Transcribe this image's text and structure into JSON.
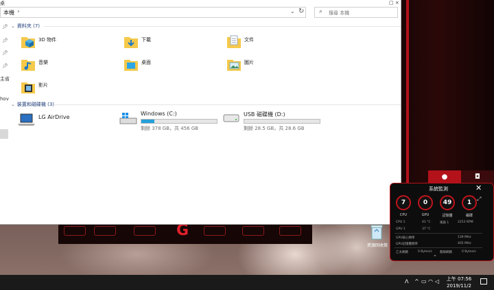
{
  "explorer": {
    "top_left_fragment": "桌",
    "top_right_controls": "▢ ×",
    "address": {
      "path": "本機",
      "separator": "›"
    },
    "search": {
      "placeholder": "搜尋 本機"
    },
    "nav": {
      "labels": [
        "主省",
        "hov"
      ]
    },
    "folders_section": {
      "title": "資料夾 (7)"
    },
    "folders": [
      {
        "name": "3D 物件",
        "icon": "3d-objects-icon"
      },
      {
        "name": "下載",
        "icon": "downloads-icon"
      },
      {
        "name": "文件",
        "icon": "documents-icon"
      },
      {
        "name": "音樂",
        "icon": "music-icon"
      },
      {
        "name": "桌面",
        "icon": "desktop-icon"
      },
      {
        "name": "圖片",
        "icon": "pictures-icon"
      },
      {
        "name": "影片",
        "icon": "videos-icon"
      }
    ],
    "drives_section": {
      "title": "裝置和磁碟機 (3)"
    },
    "drives": [
      {
        "name": "LG AirDrive",
        "icon": "laptop-icon",
        "bar": false
      },
      {
        "name": "Windows (C:)",
        "icon": "windows-drive-icon",
        "bar": true,
        "used_fraction": 0.17,
        "info": "剩餘 378 GB，共 456 GB"
      },
      {
        "name": "USB 磁碟機 (D:)",
        "icon": "usb-drive-icon",
        "bar": true,
        "used_fraction": 0.0,
        "info": "剩餘 28.5 GB，共 28.6 GB"
      }
    ]
  },
  "desktop": {
    "icon_label": "資源回收筒"
  },
  "monitor": {
    "title": "系統監測",
    "gauges": [
      {
        "value": "7",
        "label": "CPU"
      },
      {
        "value": "0",
        "label": "GPU"
      },
      {
        "value": "49",
        "label": "記憶體"
      },
      {
        "value": "1",
        "label": "磁碟"
      }
    ],
    "rows": [
      {
        "label": "CPU 1",
        "value": "41 °C",
        "label2": "風扇 1",
        "value2": "2253 RPM"
      },
      {
        "label": "GPU 1",
        "value": "37 °C",
        "label2": "",
        "value2": ""
      },
      {
        "label": "GPU核心頻率",
        "value": "139 MHz",
        "label2": "",
        "value2": ""
      },
      {
        "label": "GPU記憶體頻率",
        "value": "405 MHz",
        "label2": "",
        "value2": ""
      },
      {
        "label": "乙太網路",
        "value": "0 Bytes/s",
        "label2": "無線網路",
        "value2": "0 Bytes/s"
      }
    ]
  },
  "taskbar": {
    "time": "上午 07:56",
    "date": "2019/11/2"
  },
  "colors": {
    "accent_red": "#b3121a",
    "drive_fill": "#26a0da",
    "section_title": "#1e3d78"
  }
}
